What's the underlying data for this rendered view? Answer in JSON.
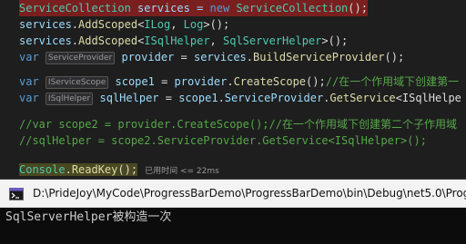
{
  "editor": {
    "line1": {
      "a": "ServiceCollection",
      "b": " services = ",
      "c": "new",
      "d": " ",
      "e": "ServiceCollection",
      "f": "();"
    },
    "line2": {
      "a": "services",
      "b": ".",
      "c": "AddScoped",
      "d": "<",
      "e": "ILog",
      "f": ", ",
      "g": "Log",
      "h": ">();"
    },
    "line3": {
      "a": "services",
      "b": ".",
      "c": "AddScoped",
      "d": "<",
      "e": "ISqlHelper",
      "f": ", ",
      "g": "SqlServerHelper",
      "h": ">();"
    },
    "line4": {
      "a": "var",
      "badge": "ServiceProvider",
      "b": " provider",
      "c": " = ",
      "d": "services",
      "e": ".",
      "f": "BuildServiceProvider",
      "g": "();"
    },
    "line5": {
      "a": "var",
      "badge": "IServiceScope",
      "b": " scope1",
      "c": " = ",
      "d": "provider",
      "e": ".",
      "f": "CreateScope",
      "g": "();",
      "h": "//在一个作用域下创建第一"
    },
    "line6": {
      "a": "var",
      "badge": "ISqlHelper",
      "b": " sqlHelper",
      "c": " = ",
      "d": "scope1",
      "e": ".",
      "f": "ServiceProvider",
      "g": ".",
      "h": "GetService",
      "i": "<ISqlHelpe"
    },
    "line7": "//var scope2 = provider.CreateScope();//在一个作用域下创建第二个子作用域",
    "line8": "//sqlHelper = scope2.ServiceProvider.GetService<ISqlHelper>();",
    "line9": {
      "a": "Console",
      "b": ".",
      "c": "ReadKey",
      "d": "();",
      "hint": "已用时间 <= 22ms"
    }
  },
  "console": {
    "title_path": "D:\\PrideJoy\\MyCode\\ProgressBarDemo\\ProgressBarDemo\\bin\\Debug\\net5.0\\Prog",
    "output": "SqlServerHelper被构造一次"
  }
}
